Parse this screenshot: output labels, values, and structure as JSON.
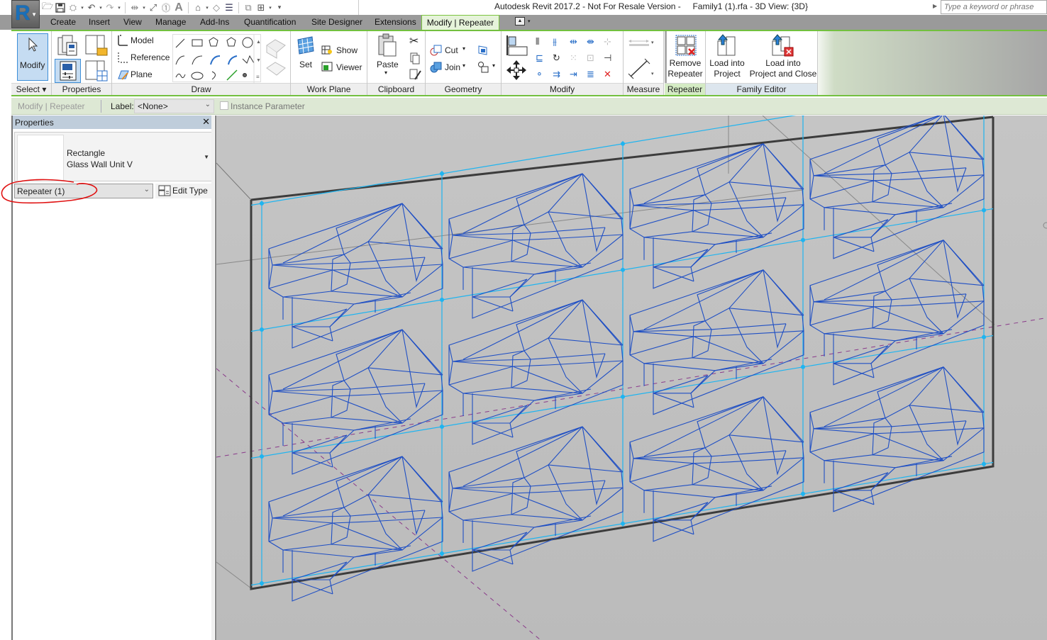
{
  "app": {
    "window_title": "Autodesk Revit 2017.2 - Not For Resale Version -     Family1 (1).rfa - 3D View: {3D}",
    "app_button_letter": "R",
    "search_placeholder": "Type a keyword or phrase"
  },
  "quick_access": [
    {
      "icon": "open-folder-icon"
    },
    {
      "icon": "save-icon"
    },
    {
      "icon": "sync-icon"
    },
    {
      "icon": "undo-icon"
    },
    {
      "icon": "redo-icon"
    },
    {
      "icon": "measure-icon"
    },
    {
      "icon": "aligned-dimension-icon"
    },
    {
      "icon": "tag-icon"
    },
    {
      "icon": "text-icon"
    },
    {
      "icon": "3d-view-icon"
    },
    {
      "icon": "section-icon"
    },
    {
      "icon": "thin-lines-icon"
    },
    {
      "icon": "close-hidden-windows-icon"
    },
    {
      "icon": "switch-windows-icon"
    },
    {
      "icon": "customize-icon"
    }
  ],
  "tabs": [
    {
      "label": "Create"
    },
    {
      "label": "Insert"
    },
    {
      "label": "View"
    },
    {
      "label": "Manage"
    },
    {
      "label": "Add-Ins"
    },
    {
      "label": "Quantification"
    },
    {
      "label": "Site Designer"
    },
    {
      "label": "Extensions"
    },
    {
      "label": "Modify | Repeater",
      "active": true
    }
  ],
  "ribbon": {
    "select": {
      "modify_label": "Modify",
      "panel_label": "Select ▾"
    },
    "properties": {
      "panel_label": "Properties"
    },
    "draw": {
      "model_label": "Model",
      "reference_label": "Reference",
      "plane_label": "Plane",
      "panel_label": "Draw"
    },
    "work_plane": {
      "set_label": "Set",
      "show_label": "Show",
      "viewer_label": "Viewer",
      "panel_label": "Work Plane"
    },
    "clipboard": {
      "paste_label": "Paste",
      "panel_label": "Clipboard"
    },
    "geometry": {
      "cut_label": "Cut",
      "join_label": "Join",
      "panel_label": "Geometry"
    },
    "modify": {
      "panel_label": "Modify"
    },
    "measure": {
      "panel_label": "Measure"
    },
    "repeater": {
      "remove_line1": "Remove",
      "remove_line2": "Repeater",
      "panel_label": "Repeater"
    },
    "family_editor": {
      "load_project_line1": "Load into",
      "load_project_line2": "Project",
      "load_close_line1": "Load into",
      "load_close_line2": "Project and Close",
      "panel_label": "Family Editor"
    }
  },
  "options_bar": {
    "context": "Modify | Repeater",
    "label_text": "Label:",
    "label_value": "<None>",
    "instance_parameter_label": "Instance Parameter",
    "instance_parameter_checked": false
  },
  "properties_palette": {
    "title": "Properties",
    "type_family": "Rectangle",
    "type_name": "Glass Wall Unit V",
    "instance_filter": "Repeater (1)",
    "edit_type_label": "Edit Type"
  },
  "viewport": {
    "view_name": "3D View: {3D}",
    "grid_rows": 3,
    "grid_cols": 4,
    "colors": {
      "wireframe": "#1f4fc4",
      "guide": "#1eb4f0",
      "edge": "#3c3c3c",
      "dashed_axis": "#8a3a8a",
      "background": "#c2c2c2"
    }
  },
  "annotation": {
    "color": "#e01010"
  }
}
